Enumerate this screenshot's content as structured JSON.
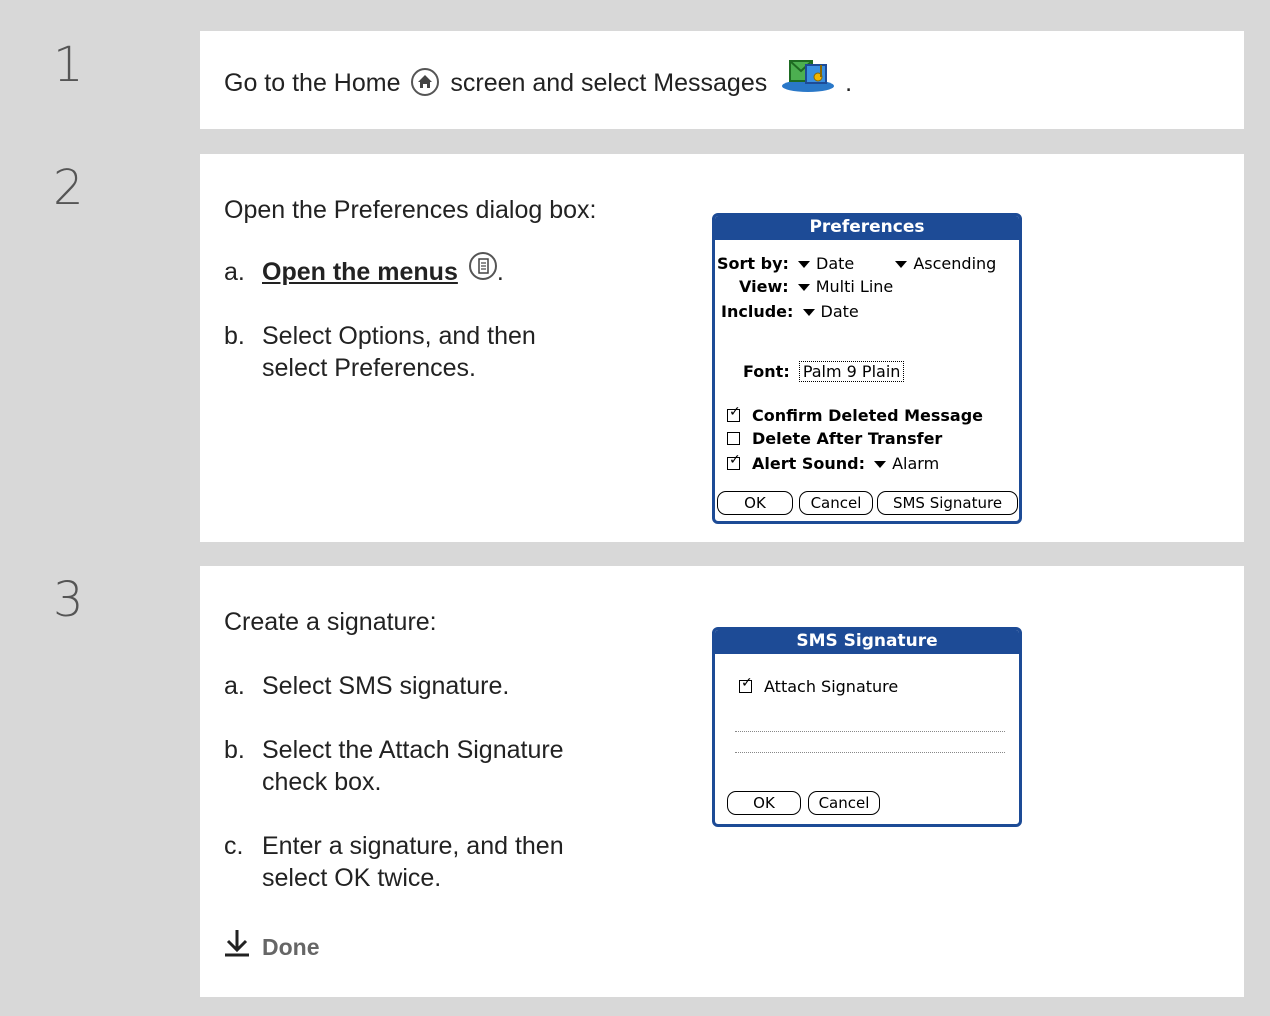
{
  "steps": [
    {
      "number": "1",
      "text_before": "Go to the Home",
      "text_middle": "screen and select Messages",
      "text_after": "."
    },
    {
      "number": "2",
      "intro": "Open the Preferences dialog box:",
      "a_label": "a.",
      "a_link": "Open the menus",
      "a_after": ".",
      "b_label": "b.",
      "b_line1": "Select Options, and then",
      "b_line2": "select Preferences."
    },
    {
      "number": "3",
      "intro": "Create a signature:",
      "a_label": "a.",
      "a_text": "Select SMS signature.",
      "b_label": "b.",
      "b_line1": "Select the Attach Signature",
      "b_line2": "check box.",
      "c_label": "c.",
      "c_line1": "Enter a signature, and then",
      "c_line2": "select OK twice.",
      "done": "Done"
    }
  ],
  "preferences": {
    "title": "Preferences",
    "sort_label": "Sort by:",
    "sort_value": "Date",
    "order_value": "Ascending",
    "view_label": "View:",
    "view_value": "Multi Line",
    "include_label": "Include:",
    "include_value": "Date",
    "font_label": "Font:",
    "font_value": "Palm 9 Plain",
    "confirm_label": "Confirm Deleted Message",
    "confirm_checked": true,
    "delete_label": "Delete After Transfer",
    "delete_checked": false,
    "alert_label": "Alert Sound:",
    "alert_value": "Alarm",
    "alert_checked": true,
    "ok": "OK",
    "cancel": "Cancel",
    "sms": "SMS Signature"
  },
  "sms_signature": {
    "title": "SMS Signature",
    "attach_label": "Attach Signature",
    "attach_checked": true,
    "ok": "OK",
    "cancel": "Cancel"
  },
  "colors": {
    "dialog_blue": "#1d4b96",
    "frame_gray": "#d8d8d8"
  },
  "icons": [
    "home-icon",
    "messages-icon",
    "menu-icon",
    "done-arrow-icon"
  ]
}
